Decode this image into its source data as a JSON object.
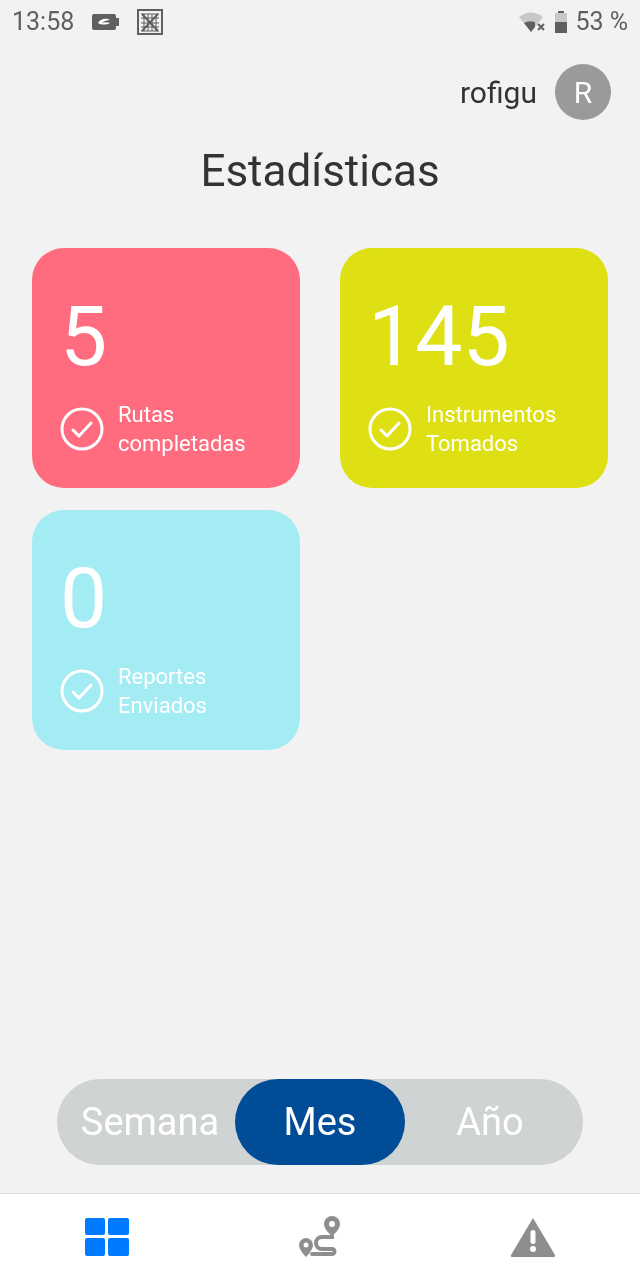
{
  "status_bar": {
    "time": "13:58",
    "battery": "53 %"
  },
  "user": {
    "name": "rofigu",
    "initial": "R"
  },
  "title": "Estadísticas",
  "cards": [
    {
      "value": "5",
      "label_lines": [
        "Rutas",
        "completadas"
      ],
      "color": "#ff6b7f"
    },
    {
      "value": "145",
      "label_lines": [
        "Instrumentos",
        "Tomados"
      ],
      "color": "#dfe013"
    },
    {
      "value": "0",
      "label_lines": [
        "Reportes",
        "Enviados"
      ],
      "color": "#a4ecf4"
    }
  ],
  "period": [
    {
      "label": "Semana",
      "selected": false
    },
    {
      "label": "Mes",
      "selected": true
    },
    {
      "label": "Año",
      "selected": false
    }
  ],
  "nav": [
    {
      "kind": "dashboard",
      "selected": true
    },
    {
      "kind": "route",
      "selected": false
    },
    {
      "kind": "alert",
      "selected": false
    }
  ]
}
